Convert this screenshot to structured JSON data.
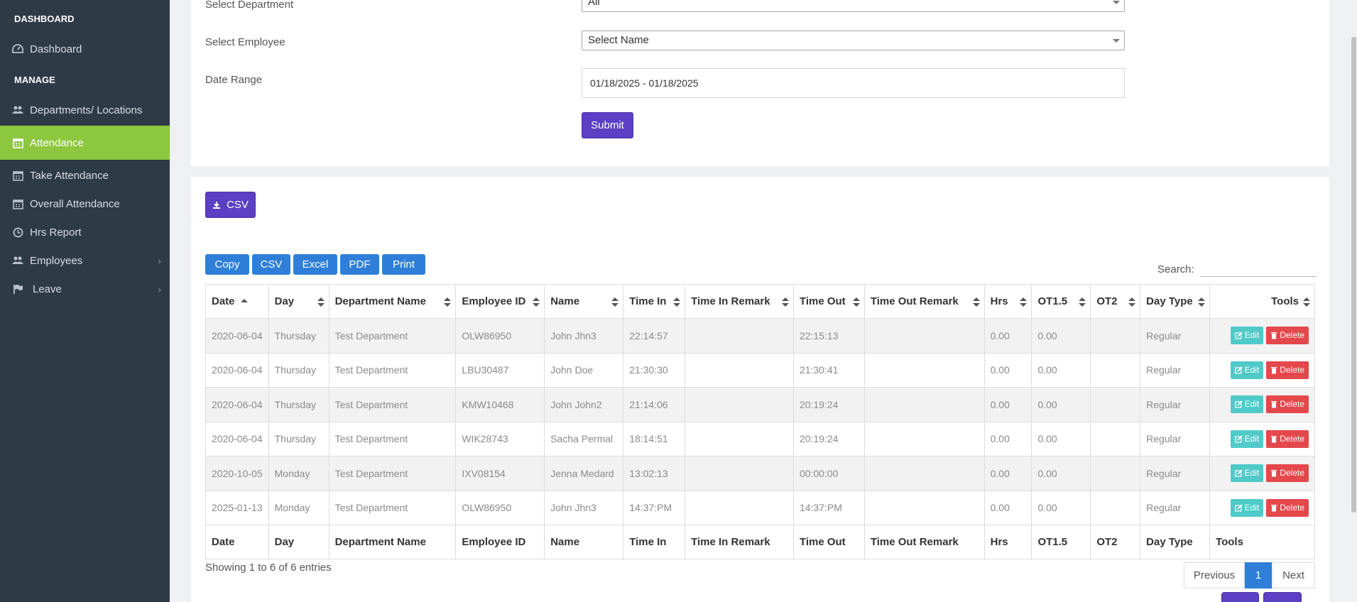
{
  "sidebar": {
    "sections": [
      "DASHBOARD",
      "MANAGE"
    ],
    "items": [
      {
        "label": "Dashboard",
        "icon": "dashboard-icon"
      },
      {
        "label": "Departments/ Locations",
        "icon": "users-icon"
      },
      {
        "label": "Attendance",
        "icon": "calendar-icon",
        "active": true
      },
      {
        "label": "Take Attendance",
        "icon": "calendar-icon"
      },
      {
        "label": "Overall Attendance",
        "icon": "calendar-icon"
      },
      {
        "label": "Hrs Report",
        "icon": "clock-icon"
      },
      {
        "label": "Employees",
        "icon": "users-icon",
        "submenu": true
      },
      {
        "label": "Leave",
        "icon": "flag-icon",
        "submenu": true
      }
    ]
  },
  "filters": {
    "department_label": "Select Department",
    "department_value": "All",
    "employee_label": "Select Employee",
    "employee_value": "Select Name",
    "date_label": "Date Range",
    "date_value": "01/18/2025 - 01/18/2025",
    "submit_label": "Submit"
  },
  "export": {
    "csv_label": "CSV",
    "buttons": [
      "Copy",
      "CSV",
      "Excel",
      "PDF",
      "Print"
    ],
    "search_label": "Search:"
  },
  "table": {
    "columns": [
      "Date",
      "Day",
      "Department Name",
      "Employee ID",
      "Name",
      "Time In",
      "Time In Remark",
      "Time Out",
      "Time Out Remark",
      "Hrs",
      "OT1.5",
      "OT2",
      "Day Type",
      "Tools"
    ],
    "rows": [
      [
        "2020-06-04",
        "Thursday",
        "Test Department",
        "OLW86950",
        "John Jhn3",
        "22:14:57",
        "",
        "22:15:13",
        "",
        "0.00",
        "0.00",
        "",
        "Regular"
      ],
      [
        "2020-06-04",
        "Thursday",
        "Test Department",
        "LBU30487",
        "John Doe",
        "21:30:30",
        "",
        "21:30:41",
        "",
        "0.00",
        "0.00",
        "",
        "Regular"
      ],
      [
        "2020-06-04",
        "Thursday",
        "Test Department",
        "KMW10468",
        "John John2",
        "21:14:06",
        "",
        "20:19:24",
        "",
        "0.00",
        "0.00",
        "",
        "Regular"
      ],
      [
        "2020-06-04",
        "Thursday",
        "Test Department",
        "WIK28743",
        "Sacha Permal",
        "18:14:51",
        "",
        "20:19:24",
        "",
        "0.00",
        "0.00",
        "",
        "Regular"
      ],
      [
        "2020-10-05",
        "Monday",
        "Test Department",
        "IXV08154",
        "Jenna Medard",
        "13:02:13",
        "",
        "00:00:00",
        "",
        "0.00",
        "0.00",
        "",
        "Regular"
      ],
      [
        "2025-01-13",
        "Monday",
        "Test Department",
        "OLW86950",
        "John Jhn3",
        "14:37:PM",
        "",
        "14:37:PM",
        "",
        "0.00",
        "0.00",
        "",
        "Regular"
      ]
    ],
    "edit_label": "Edit",
    "delete_label": "Delete",
    "info": "Showing 1 to 6 of 6 entries",
    "pagination": {
      "previous": "Previous",
      "current": "1",
      "next": "Next"
    }
  },
  "colors": {
    "sidebar_bg": "#2f3a47",
    "active": "#8dc63f",
    "primary": "#5b3fc4",
    "dt_button": "#2f7fd8",
    "edit": "#4fcac8",
    "delete": "#e4484b"
  }
}
